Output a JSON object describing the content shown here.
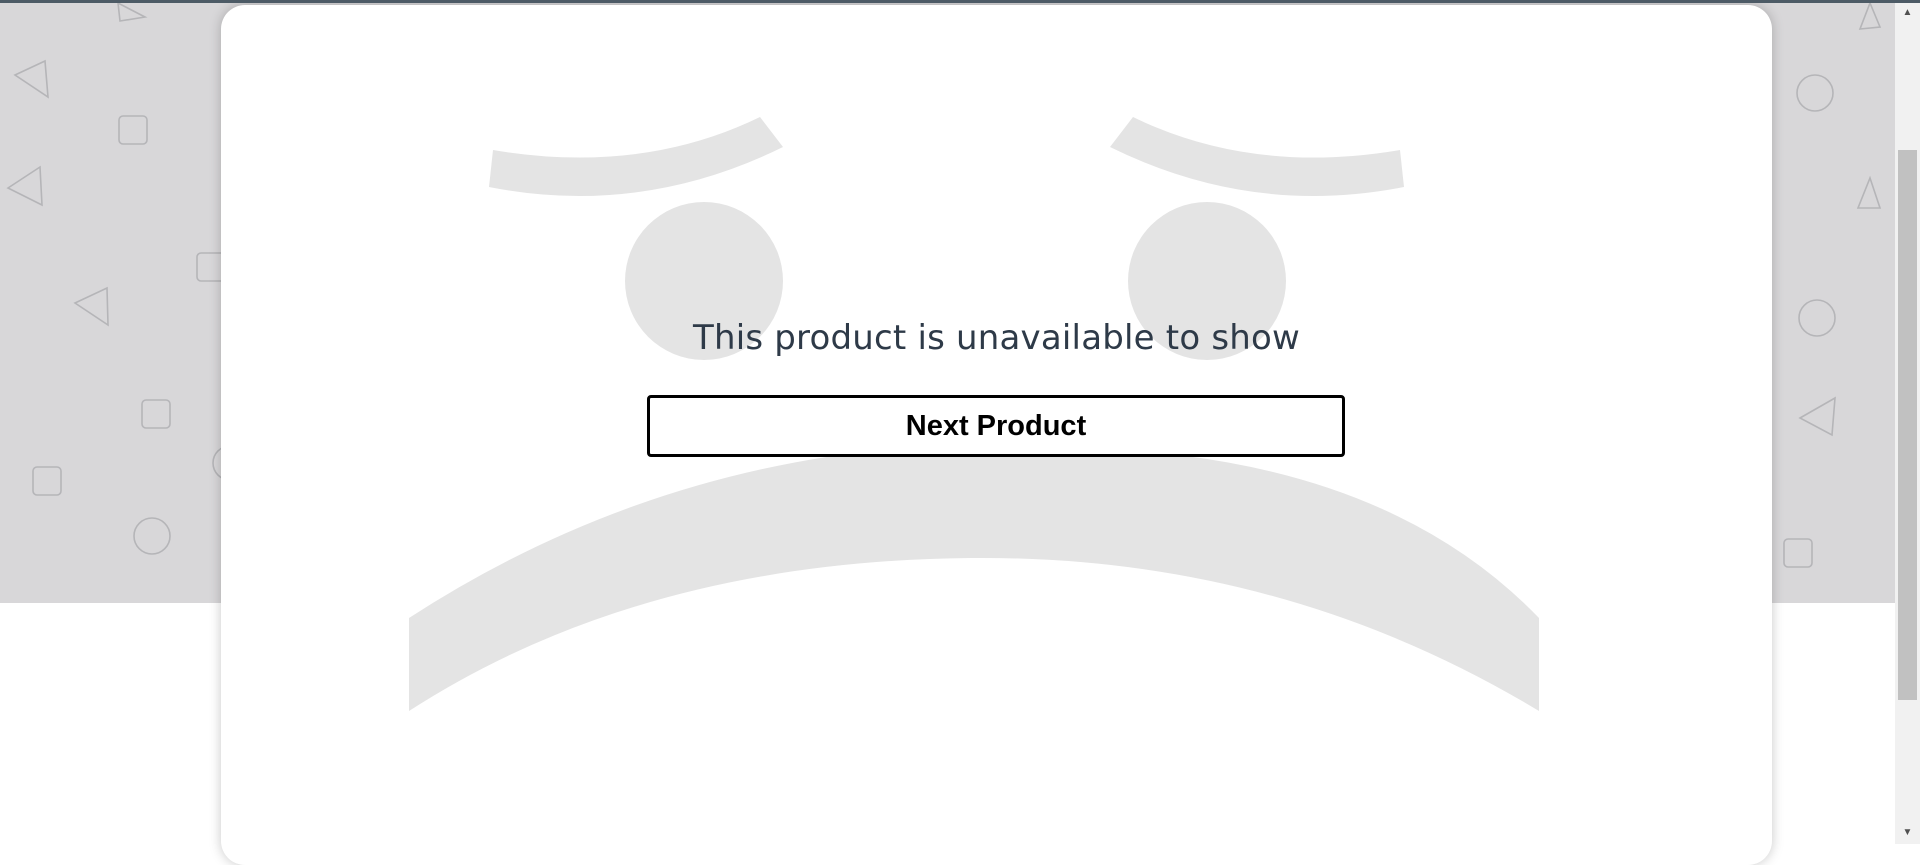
{
  "product_unavailable": {
    "message": "This product is unavailable to show",
    "next_button_label": "Next Product"
  },
  "icons": {
    "background_pattern": "scattered-shapes-pattern",
    "illustration": "sad-face-illustration"
  },
  "scrollbar": {
    "up_arrow": "▲",
    "down_arrow": "▼"
  },
  "colors": {
    "background_gray": "#d8d7d9",
    "card": "#ffffff",
    "face_shapes": "#e4e4e4",
    "message_text": "#2e3a48",
    "button_border": "#000000"
  }
}
